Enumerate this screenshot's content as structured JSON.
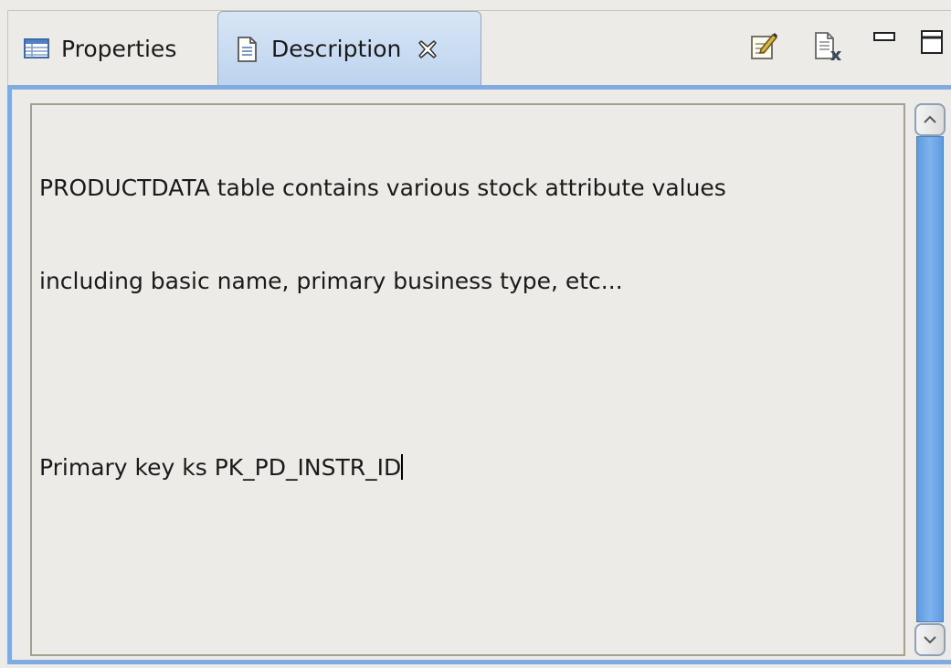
{
  "tabs": [
    {
      "label": "Properties",
      "icon": "properties-table-icon",
      "active": false
    },
    {
      "label": "Description",
      "icon": "document-icon",
      "active": true,
      "closable": true
    }
  ],
  "toolbar": {
    "buttons": [
      {
        "icon": "edit-description-icon"
      },
      {
        "icon": "clear-description-icon"
      },
      {
        "icon": "minimize-icon"
      },
      {
        "icon": "maximize-icon"
      }
    ]
  },
  "editor": {
    "lines": [
      "PRODUCTDATA table contains various stock attribute values",
      "including basic name, primary business type, etc...",
      "",
      "Primary key ks PK_PD_INSTR_ID"
    ]
  },
  "colors": {
    "active_tab": "#bcd3ee",
    "frame_border": "#7fabe0",
    "scroll_thumb": "#6fa6e6",
    "background": "#edebe7"
  }
}
